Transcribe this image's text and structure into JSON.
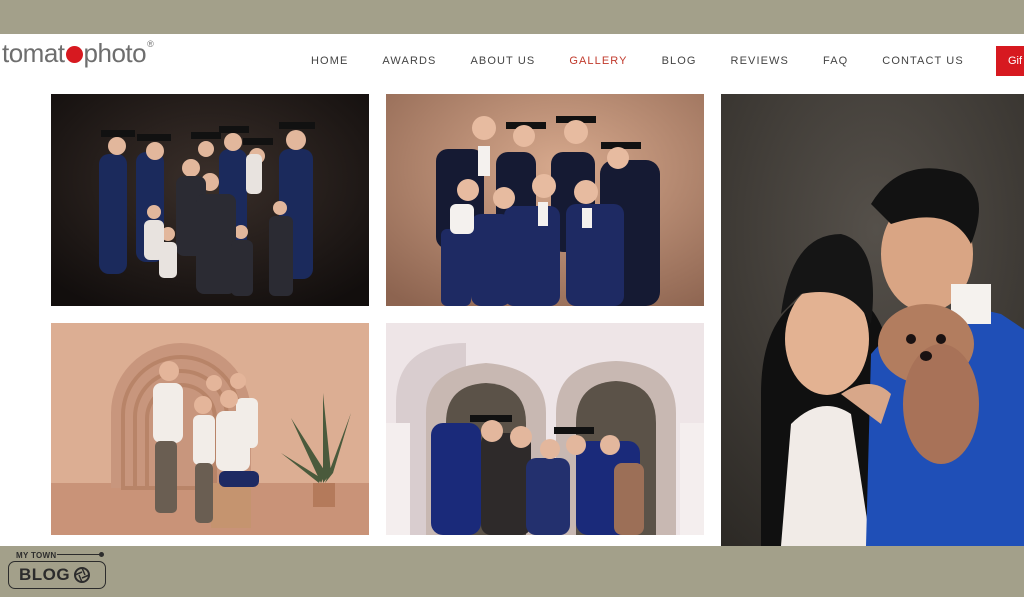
{
  "header": {
    "logo": {
      "before": "tomat",
      "after": "photo",
      "reg": "®"
    },
    "nav": [
      "HOME",
      "AWARDS",
      "ABOUT US",
      "GALLERY",
      "BLOG",
      "REVIEWS",
      "FAQ",
      "CONTACT US"
    ],
    "active_nav": "GALLERY",
    "gift_button": "Gif"
  },
  "gallery": {
    "photos": [
      {
        "name": "graduation-family-dark-backdrop",
        "icon": "photo"
      },
      {
        "name": "graduation-family-brown-backdrop",
        "icon": "photo"
      },
      {
        "name": "family-arch-backdrop",
        "icon": "photo"
      },
      {
        "name": "graduation-family-arches",
        "icon": "photo"
      },
      {
        "name": "couple-with-dog-graduation",
        "icon": "photo"
      }
    ]
  },
  "badge": {
    "small": "MY TOWN",
    "main": "BLOG"
  },
  "colors": {
    "brand": "#d71920",
    "accent_nav": "#c0392b",
    "band": "#a3a08a"
  }
}
